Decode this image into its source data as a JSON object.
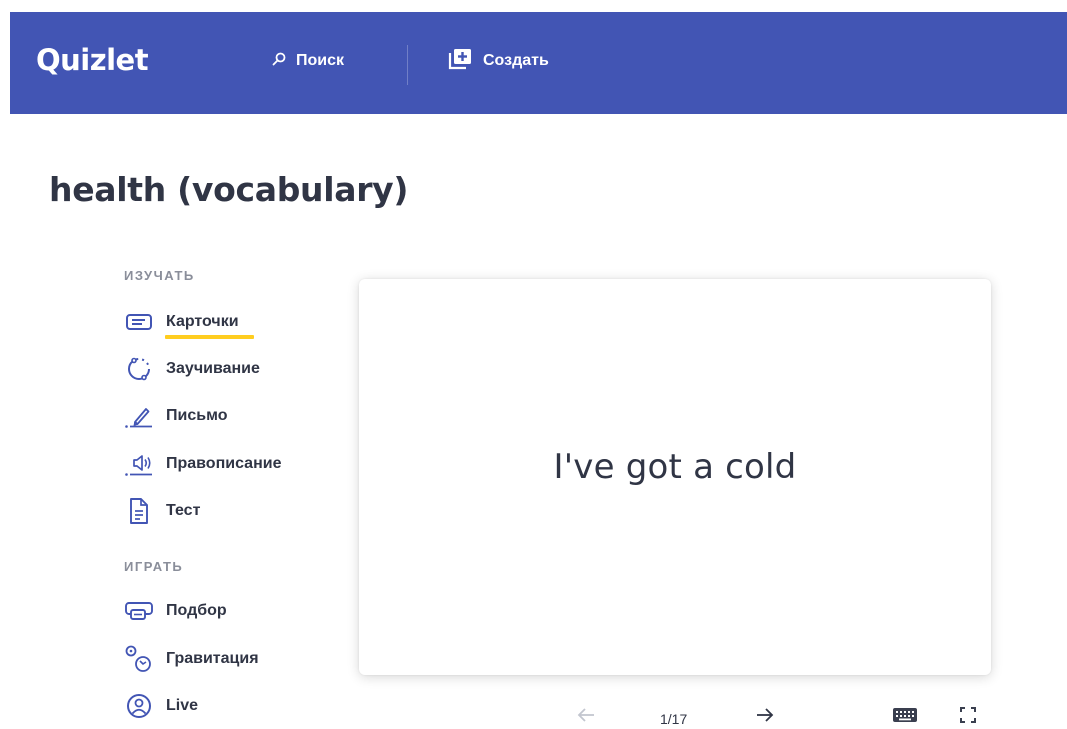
{
  "header": {
    "logo": "Quizlet",
    "search_label": "Поиск",
    "create_label": "Создать",
    "brand_color": "#4255b4"
  },
  "page": {
    "title": "health (vocabulary)"
  },
  "sidebar": {
    "study_heading": "ИЗУЧАТЬ",
    "study_items": [
      {
        "label": "Карточки",
        "icon": "cards-icon",
        "active": true
      },
      {
        "label": "Заучивание",
        "icon": "learn-icon"
      },
      {
        "label": "Письмо",
        "icon": "write-icon"
      },
      {
        "label": "Правописание",
        "icon": "spell-icon"
      },
      {
        "label": "Тест",
        "icon": "test-icon"
      }
    ],
    "play_heading": "ИГРАТЬ",
    "play_items": [
      {
        "label": "Подбор",
        "icon": "match-icon"
      },
      {
        "label": "Гравитация",
        "icon": "gravity-icon"
      },
      {
        "label": "Live",
        "icon": "live-icon"
      }
    ],
    "active_color": "#ffcd1f"
  },
  "card": {
    "term": "I've got a cold"
  },
  "controls": {
    "counter": "1/17",
    "prev_icon": "arrow-left-icon",
    "next_icon": "arrow-right-icon",
    "keyboard_icon": "keyboard-icon",
    "fullscreen_icon": "fullscreen-icon"
  }
}
